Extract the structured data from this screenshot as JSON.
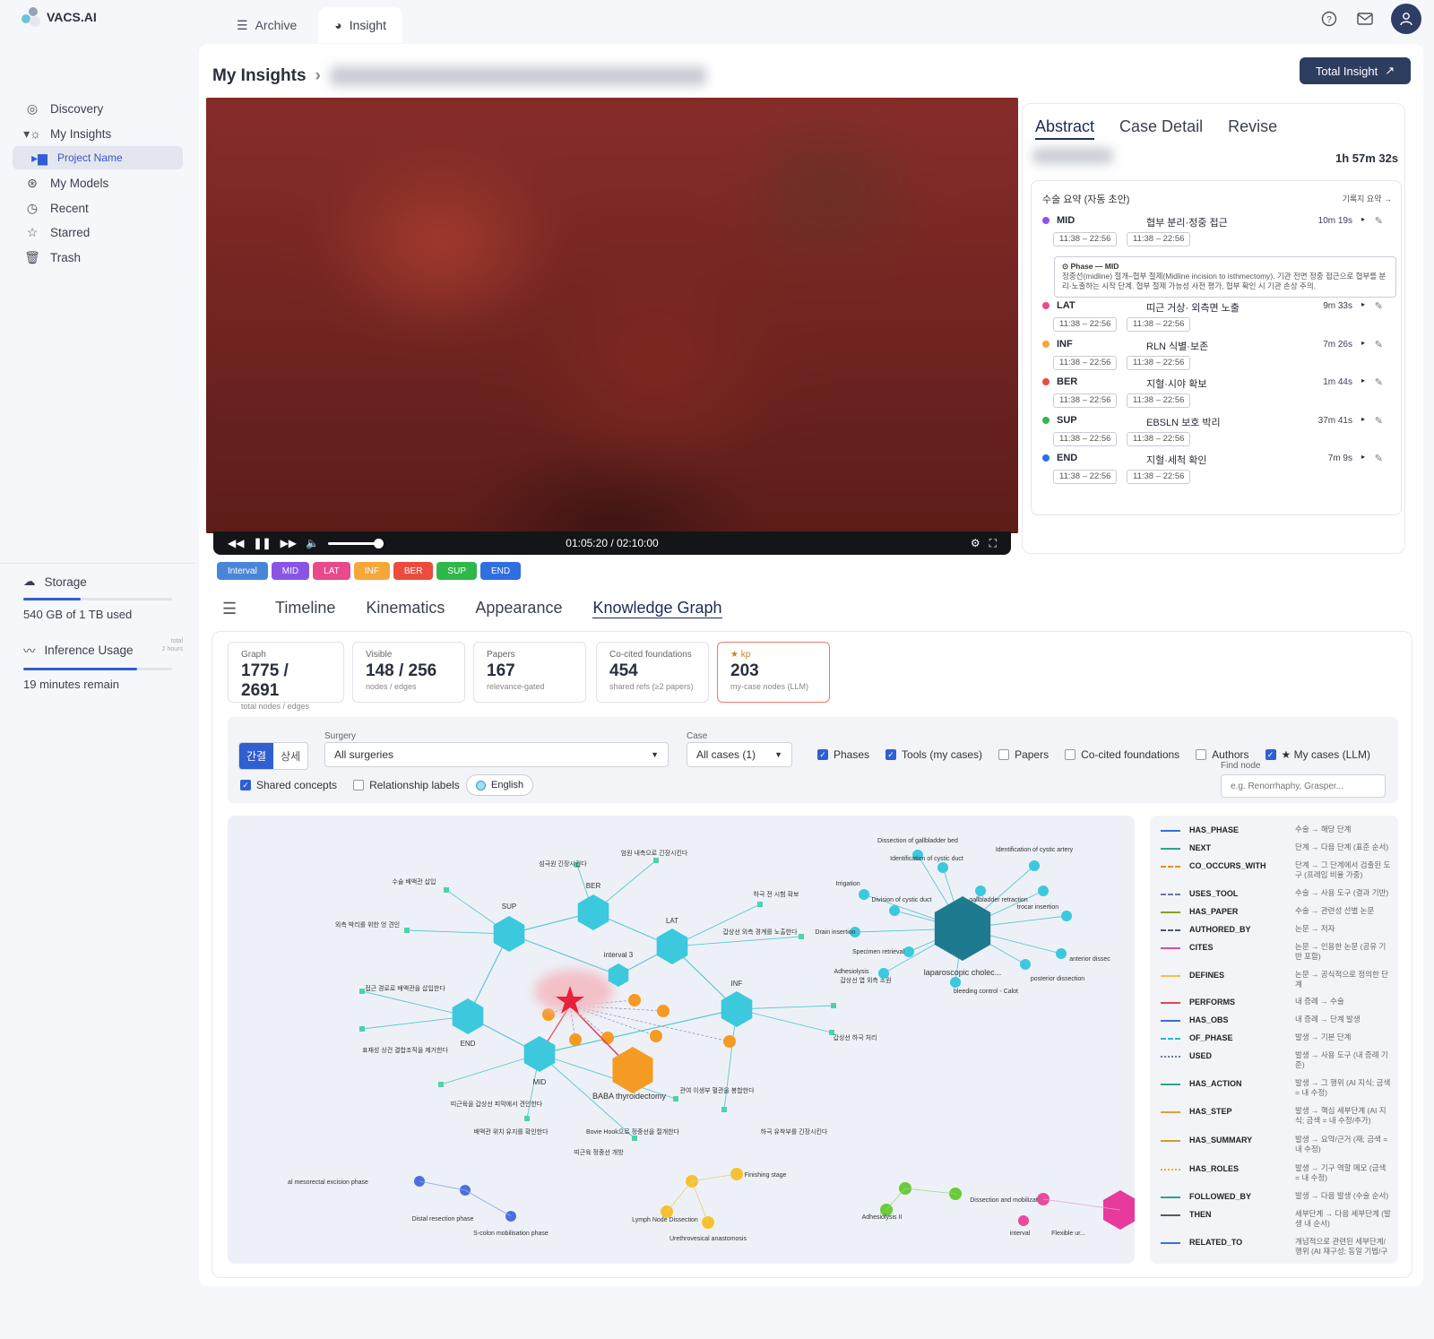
{
  "app": {
    "name": "VACS.AI"
  },
  "topnav": {
    "tabs": [
      {
        "label": "Archive"
      },
      {
        "label": "Insight"
      }
    ]
  },
  "sidebar": {
    "items": [
      {
        "label": "Discovery"
      },
      {
        "label": "My Insights"
      },
      {
        "label": "Project Name"
      },
      {
        "label": "My Models"
      },
      {
        "label": "Recent"
      },
      {
        "label": "Starred"
      },
      {
        "label": "Trash"
      }
    ],
    "storage": {
      "label": "Storage",
      "used_text": "540 GB of 1 TB used",
      "fraction": 0.54
    },
    "inference": {
      "label": "Inference Usage",
      "total_label": "total",
      "total_value": "2 hours",
      "remain_text": "19 minutes remain",
      "fraction": 0.84
    }
  },
  "page": {
    "title": "My Insights",
    "total_insight_button": "Total Insight"
  },
  "video": {
    "time": "01:05:20 / 02:10:00",
    "progress": 0.5
  },
  "phase_buttons": [
    {
      "label": "Interval",
      "color": "#4a86d8"
    },
    {
      "label": "MID",
      "color": "#8a55e6"
    },
    {
      "label": "LAT",
      "color": "#e84a8c"
    },
    {
      "label": "INF",
      "color": "#f5a73a"
    },
    {
      "label": "BER",
      "color": "#ec4b3e"
    },
    {
      "label": "SUP",
      "color": "#2fb84a"
    },
    {
      "label": "END",
      "color": "#2f6fe0"
    }
  ],
  "right_panel": {
    "tabs": [
      "Abstract",
      "Case Detail",
      "Revise"
    ],
    "duration": "1h 57m 32s",
    "summary_title": "수술 요약 (자동 초안)",
    "summary_link": "기록지 요약 →",
    "phases": [
      {
        "code": "MID",
        "name": "협부 분리·정중 접근",
        "duration": "10m 19s",
        "color": "#8a55e6",
        "tags": [
          "11:38 – 22:56",
          "11:38 – 22:56"
        ]
      },
      {
        "code": "LAT",
        "name": "띠근 거상· 외측면 노출",
        "duration": "9m 33s",
        "color": "#e84a8c",
        "tags": [
          "11:38 – 22:56",
          "11:38 – 22:56"
        ]
      },
      {
        "code": "INF",
        "name": "RLN 식별·보존",
        "duration": "7m 26s",
        "color": "#f5a73a",
        "tags": [
          "11:38 – 22:56",
          "11:38 – 22:56"
        ]
      },
      {
        "code": "BER",
        "name": "지혈·시야 확보",
        "duration": "1m 44s",
        "color": "#ec4b3e",
        "tags": [
          "11:38 – 22:56",
          "11:38 – 22:56"
        ]
      },
      {
        "code": "SUP",
        "name": "EBSLN 보호 박리",
        "duration": "37m 41s",
        "color": "#2fb84a",
        "tags": [
          "11:38 – 22:56",
          "11:38 – 22:56"
        ]
      },
      {
        "code": "END",
        "name": "지혈·세척 확인",
        "duration": "7m 9s",
        "color": "#2f6fe0",
        "tags": [
          "11:38 – 22:56",
          "11:38 – 22:56"
        ]
      }
    ],
    "note": {
      "title": "⊙ Phase — MID",
      "text": "정중선(midline) 절개–협부 절제(Midline incision to isthmectomy). 기관 전면 정중 접근으로 협부를 분리·노출하는 시작 단계. 협부 절제 가능성 사전 평가, 협부 확인 시 기관 손상 주의."
    }
  },
  "subtabs": [
    "Timeline",
    "Kinematics",
    "Appearance",
    "Knowledge Graph"
  ],
  "stats": [
    {
      "label": "Graph",
      "value": "1775 / 2691",
      "sub": "total nodes / edges"
    },
    {
      "label": "Visible",
      "value": "148 / 256",
      "sub": "nodes / edges"
    },
    {
      "label": "Papers",
      "value": "167",
      "sub": "relevance-gated"
    },
    {
      "label": "Co-cited foundations",
      "value": "454",
      "sub": "shared refs (≥2 papers)"
    },
    {
      "label": "★ kp",
      "value": "203",
      "sub": "my-case nodes (LLM)"
    }
  ],
  "filters": {
    "view_toggle": [
      "간결",
      "상세"
    ],
    "surgery_label": "Surgery",
    "surgery_value": "All surgeries",
    "case_label": "Case",
    "case_value": "All cases (1)",
    "checks": [
      {
        "label": "Phases",
        "on": true
      },
      {
        "label": "Tools (my cases)",
        "on": true
      },
      {
        "label": "Papers",
        "on": false
      },
      {
        "label": "Co-cited foundations",
        "on": false
      },
      {
        "label": "Authors",
        "on": false
      },
      {
        "label": "★ My cases (LLM)",
        "on": true
      }
    ],
    "checks2": [
      {
        "label": "Shared concepts",
        "on": true
      },
      {
        "label": "Relationship labels",
        "on": false
      }
    ],
    "lang_button": "English",
    "find_label": "Find node",
    "find_placeholder": "e.g. Renorrhaphy, Grasper..."
  },
  "graph": {
    "phase_nodes": [
      {
        "label": "SUP",
        "color": "#3cc8dd"
      },
      {
        "label": "BER",
        "color": "#3cc8dd"
      },
      {
        "label": "LAT",
        "color": "#3cc8dd"
      },
      {
        "label": "interval 3",
        "color": "#3cc8dd"
      },
      {
        "label": "INF",
        "color": "#3cc8dd"
      },
      {
        "label": "END",
        "color": "#3cc8dd"
      },
      {
        "label": "MID",
        "color": "#3cc8dd"
      },
      {
        "label": "BABA thyroidectomy",
        "color": "#f59a23"
      },
      {
        "label": "laparoscopic cholec...",
        "color": "#1e7b8f"
      }
    ],
    "labels": [
      "수술 배액관 삽입",
      "외측 박리를 위한 엉 견인",
      "섬극원 긴장시킨다",
      "엄원 내측으로 긴장시킨다",
      "하극 전 시험 확보",
      "갑상선 외측 경계를 노출한다",
      "접근 경로로 배액관을 삽입한다",
      "표재성 상건 결합조직을 제거한다",
      "띠근육을 갑상선 피막에서 견인한다",
      "배액관 위치 유지를 확인한다",
      "Bovie Hook으로 정중선을 절개한다",
      "띠근육 정중선 개방",
      "하극 유착부를 긴장시킨다",
      "갑상선 하극 처리",
      "갑상선 엽 외측 조원",
      "관여 이생부 혈관을 봉합한다",
      "Dissection of gallbladder bed",
      "Identification of cystic artery",
      "Identification of cystic duct",
      "Irrigation",
      "Division of cystic duct",
      "gallbladder retraction",
      "trocar insertion",
      "Drain insertion",
      "Specimen retrieval",
      "anterior dissec",
      "Adhesiolysis",
      "posterior dissection",
      "bleeding control - Calot",
      "al mesorectal excision phase",
      "Distal resection phase",
      "S-colon mobilisation phase",
      "Finishing stage",
      "Lymph Node Dissection",
      "Urethrovesical anastomosis",
      "Adhesiolysis II",
      "Dissection and mobilizat",
      "interval",
      "Flexible ur..."
    ]
  },
  "legend": [
    {
      "name": "HAS_PHASE",
      "desc": "수술 → 해당 단계",
      "color": "#3b6fd8",
      "style": "solid"
    },
    {
      "name": "NEXT",
      "desc": "단계 → 다음 단계 (표준 순서)",
      "color": "#2aa58a",
      "style": "solid"
    },
    {
      "name": "CO_OCCURS_WITH",
      "desc": "단계 → 그 단계에서 검출된 도구 (프레임 비율 가중)",
      "color": "#f08a24",
      "style": "dashed"
    },
    {
      "name": "USES_TOOL",
      "desc": "수술 → 사용 도구 (결과 기반)",
      "color": "#6b7a99",
      "style": "dashed"
    },
    {
      "name": "HAS_PAPER",
      "desc": "수술 → 관련성 선별 논문",
      "color": "#8aa020",
      "style": "solid"
    },
    {
      "name": "AUTHORED_BY",
      "desc": "논문 → 저자",
      "color": "#4a5570",
      "style": "dashed"
    },
    {
      "name": "CITES",
      "desc": "논문 → 인용한 논문 (공유 기반 포함)",
      "color": "#e04d9a",
      "style": "solid"
    },
    {
      "name": "DEFINES",
      "desc": "논문 → 공식적으로 정의한 단계",
      "color": "#f5c04a",
      "style": "solid"
    },
    {
      "name": "PERFORMS",
      "desc": "내 증례 → 수술",
      "color": "#e0445a",
      "style": "solid"
    },
    {
      "name": "HAS_OBS",
      "desc": "내 증례 → 단계 발생",
      "color": "#3b6fd8",
      "style": "solid"
    },
    {
      "name": "OF_PHASE",
      "desc": "발생 → 기본 단계",
      "color": "#2ab8c8",
      "style": "dashed"
    },
    {
      "name": "USED",
      "desc": "발생 → 사용 도구 (내 증례 기준)",
      "color": "#6b7a99",
      "style": "dotted"
    },
    {
      "name": "HAS_ACTION",
      "desc": "발생 → 그 행위 (AI 지식; 금색 = 내 수정)",
      "color": "#2aa58a",
      "style": "solid"
    },
    {
      "name": "HAS_STEP",
      "desc": "발생 → 핵심 세부단계 (AI 지식; 금색 = 내 수정/추가)",
      "color": "#e0a030",
      "style": "solid"
    },
    {
      "name": "HAS_SUMMARY",
      "desc": "발생 → 요약/근거 (재; 금색 = 내 수정)",
      "color": "#c8a030",
      "style": "solid"
    },
    {
      "name": "HAS_ROLES",
      "desc": "발생 → 기구 역할 메모 (금색 = 내 수정)",
      "color": "#e0b020",
      "style": "dotted"
    },
    {
      "name": "FOLLOWED_BY",
      "desc": "발생 → 다음 발생 (수술 순서)",
      "color": "#2aa58a",
      "style": "solid"
    },
    {
      "name": "THEN",
      "desc": "세부단계 → 다음 세부단계 (발생 내 순서)",
      "color": "#555a66",
      "style": "solid"
    },
    {
      "name": "RELATED_TO",
      "desc": "개념적으로 관련된 세부단계/행위 (AI 재구성; 동일 기법/구",
      "color": "#3b6fd8",
      "style": "solid"
    }
  ]
}
